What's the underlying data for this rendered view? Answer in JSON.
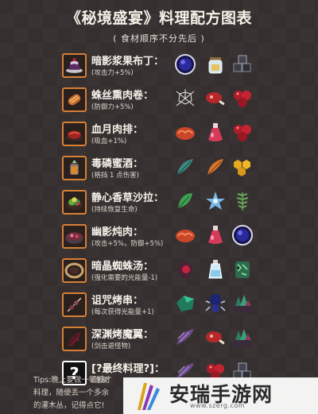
{
  "title": "《秘境盛宴》料理配方图表",
  "subtitle": "( 食材顺序不分先后 )",
  "recipes": [
    {
      "name": "暗影浆果布丁：",
      "effect": "(攻击力+5%)",
      "dish_icon": "pudding-icon",
      "ingredients": [
        "shadow-orb-icon",
        "jar-icon",
        "dark-cubes-icon"
      ]
    },
    {
      "name": "蛛丝熏肉卷：",
      "effect": "(防御力+5%)",
      "dish_icon": "meat-roll-icon",
      "ingredients": [
        "spider-web-icon",
        "ham-icon",
        "red-berries-icon"
      ]
    },
    {
      "name": "血月肉排：",
      "effect": "(吸血+1%)",
      "dish_icon": "steak-icon",
      "ingredients": [
        "brain-meat-icon",
        "red-potion-icon",
        "red-berries-icon"
      ]
    },
    {
      "name": "毒磷蜜酒：",
      "effect": "(格挡 1 点伤害)",
      "dish_icon": "mead-icon",
      "ingredients": [
        "teal-feather-icon",
        "orange-feather-icon",
        "honeycomb-icon"
      ]
    },
    {
      "name": "静心香草沙拉：",
      "effect": "(持续恢复生命)",
      "dish_icon": "salad-icon",
      "ingredients": [
        "green-leaf-icon",
        "blue-flower-icon",
        "fern-icon"
      ]
    },
    {
      "name": "幽影炖肉：",
      "effect": "(攻击+5%，防御+5%)",
      "dish_icon": "stew-icon",
      "ingredients": [
        "brain-meat-icon",
        "red-potion-icon",
        "shadow-orb-icon"
      ]
    },
    {
      "name": "暗晶蜘蛛汤：",
      "effect": "(强化需要的光能量-1)",
      "dish_icon": "soup-icon",
      "ingredients": [
        "dark-gem-icon",
        "water-bottle-icon",
        "moss-icon"
      ]
    },
    {
      "name": "诅咒烤串：",
      "effect": "(每次获得光能量+1)",
      "dish_icon": "skewer-icon",
      "ingredients": [
        "emerald-ore-icon",
        "spider-icon",
        "crystal-moss-icon"
      ]
    },
    {
      "name": "深渊烤魔翼：",
      "effect": "(剑击退怪物)",
      "dish_icon": "wing-icon",
      "ingredients": [
        "purple-fin-icon",
        "ham-icon",
        "crystal-moss-icon"
      ]
    },
    {
      "name": "[?最终料理?]：",
      "effect": "(逐渐",
      "dish_icon": "question-icon",
      "ingredients": [
        "purple-fin-icon",
        "red-berries-icon",
        "dark-cubes-icon"
      ]
    }
  ],
  "tips": [
    "Tips:晚上要做一顿饭才",
    "料理，随便丢一个多余",
    "的灌木丛，记得点它!"
  ],
  "watermark": {
    "title": "安瑞手游网",
    "url": "www.szerg.com"
  },
  "colors": {
    "background": "#35302f",
    "frame": "#d67f36"
  }
}
